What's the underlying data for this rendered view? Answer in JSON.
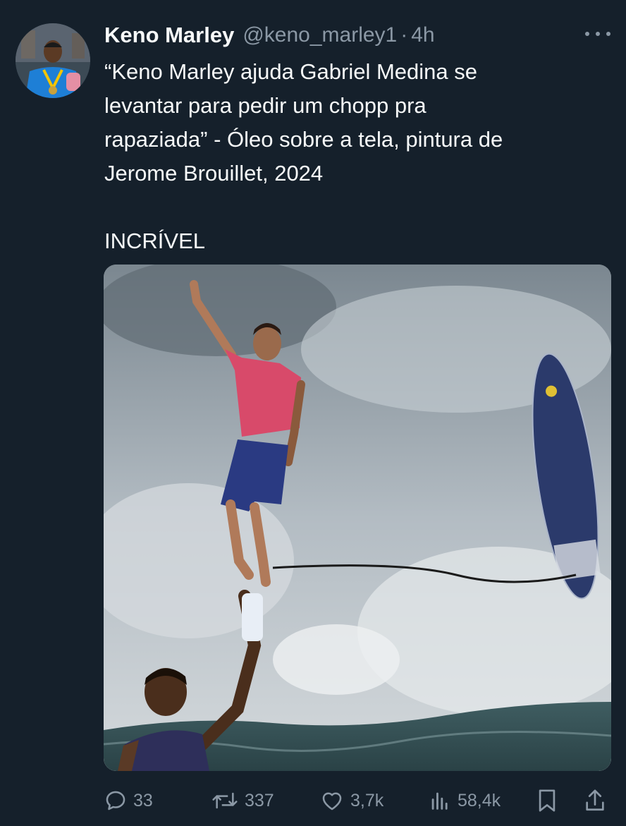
{
  "post": {
    "author_name": "Keno Marley",
    "author_handle": "@keno_marley1",
    "separator": "·",
    "time_ago": "4h",
    "more_icon": "more-horizontal-icon",
    "text": "“Keno Marley ajuda Gabriel Medina se\nlevantar para pedir um chopp pra\nrapaziada” - Óleo sobre a tela, pintura de\nJerome Brouillet, 2024\n\nINCRÍVEL"
  },
  "actions": {
    "replies": "33",
    "reposts": "337",
    "likes": "3,7k",
    "views": "58,4k",
    "reply_icon": "reply-icon",
    "repost_icon": "repost-icon",
    "like_icon": "heart-icon",
    "views_icon": "analytics-icon",
    "bookmark_icon": "bookmark-icon",
    "share_icon": "share-icon"
  },
  "colors": {
    "background": "#15202b",
    "primary_text": "#f7f9f9",
    "secondary_text": "#8b98a5"
  }
}
